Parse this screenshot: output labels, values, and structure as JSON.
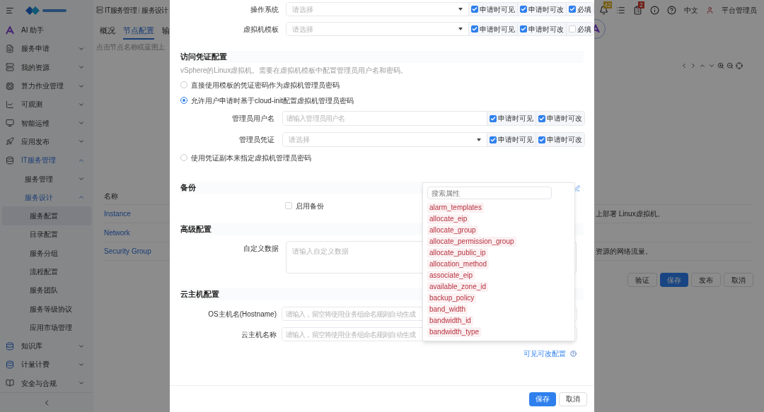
{
  "top_bar": {
    "breadcrumb": [
      "IT服务管理",
      "服务设计"
    ],
    "notification_badge": "42",
    "task_badge": "2",
    "language": "中文",
    "user": "平台管理员"
  },
  "sidebar": {
    "items": [
      {
        "label": "AI 助手",
        "selected": false
      },
      {
        "label": "服务申请",
        "selected": false,
        "expanded": false
      },
      {
        "label": "我的资源",
        "selected": false,
        "expanded": false
      },
      {
        "label": "算力作业管理",
        "selected": false,
        "expanded": false
      },
      {
        "label": "可观测",
        "selected": false,
        "expanded": false
      },
      {
        "label": "智能运维",
        "selected": false,
        "expanded": false
      },
      {
        "label": "应用发布",
        "selected": false,
        "expanded": false
      },
      {
        "label": "IT服务管理",
        "selected": false,
        "expanded": true,
        "children": [
          {
            "label": "服务管理",
            "selected": false,
            "expanded": false
          },
          {
            "label": "服务设计",
            "selected": false,
            "expanded": true,
            "children": [
              {
                "label": "服务配置",
                "selected": true
              },
              {
                "label": "目录配置",
                "selected": false
              },
              {
                "label": "服务分组",
                "selected": false
              },
              {
                "label": "流程配置",
                "selected": false
              },
              {
                "label": "服务团队",
                "selected": false
              },
              {
                "label": "服务等级协议",
                "selected": false
              },
              {
                "label": "应用市场管理",
                "selected": false
              }
            ]
          }
        ]
      },
      {
        "label": "知识库",
        "selected": false,
        "expanded": false
      },
      {
        "label": "计量计费",
        "selected": false,
        "expanded": false
      },
      {
        "label": "安全与合规",
        "selected": false,
        "expanded": false
      }
    ]
  },
  "page": {
    "tabs": [
      {
        "label": "概况",
        "selected": false
      },
      {
        "label": "节点配置",
        "selected": true
      },
      {
        "label": "输",
        "selected": false
      }
    ],
    "hint": "点击节点名称或蓝图上",
    "table": {
      "columns": [
        "名称"
      ],
      "rows": [
        {
          "name": "Instance",
          "column_2": "上部署 Linux虚拟机。"
        },
        {
          "name": "Network"
        },
        {
          "name": "Security Group",
          "column_2": "资源的网络流量。"
        }
      ]
    },
    "buttons": [
      {
        "label": "验证",
        "kind": "default"
      },
      {
        "label": "保存",
        "kind": "primary"
      },
      {
        "label": "发布",
        "kind": "default"
      },
      {
        "label": "取消",
        "kind": "default"
      }
    ]
  },
  "modal": {
    "basic_fields": [
      {
        "label": "操作系统",
        "kind": "select",
        "placeholder": "请选择",
        "options": [
          {
            "label": "申请时可见",
            "checked": true
          },
          {
            "label": "申请时可改",
            "checked": true
          },
          {
            "label": "必填",
            "checked": true
          }
        ]
      },
      {
        "label": "虚拟机模板",
        "kind": "select",
        "placeholder": "请选择",
        "options": [
          {
            "label": "申请时可见",
            "checked": true
          },
          {
            "label": "申请时可改",
            "checked": true
          },
          {
            "label": "必填",
            "checked": false
          }
        ]
      }
    ],
    "credential_section": {
      "title": "访问凭证配置",
      "description": "vSphere的Linux虚拟机。需要在虚拟机模板中配置管理员用户名和密码。",
      "choices": [
        {
          "label": "直接使用模板的凭证密码作为虚拟机管理员密码",
          "selected": false
        },
        {
          "label": "允许用户申请时基于cloud-init配置虚拟机管理员密码",
          "selected": true,
          "fields": [
            {
              "label": "管理员用户名",
              "kind": "input",
              "placeholder": "请输入管理员用户名",
              "options": [
                {
                  "label": "申请时可见",
                  "checked": true
                },
                {
                  "label": "申请时可改",
                  "checked": true
                }
              ]
            },
            {
              "label": "管理员凭证",
              "kind": "select",
              "placeholder": "请选择",
              "options": [
                {
                  "label": "申请时可见",
                  "checked": true
                },
                {
                  "label": "申请时可改",
                  "checked": true
                }
              ]
            }
          ]
        },
        {
          "label": "使用凭证副本来指定虚拟机管理员密码",
          "selected": false
        }
      ]
    },
    "backup_section": {
      "title": "备份",
      "enable": {
        "label": "启用备份",
        "checked": false
      }
    },
    "advanced_section": {
      "title": "高级配置",
      "fields": [
        {
          "label": "自定义数据",
          "kind": "textarea",
          "placeholder": "请输入自定义数据"
        }
      ]
    },
    "vm_section": {
      "title": "云主机配置",
      "fields": [
        {
          "label": "OS主机名(Hostname)",
          "placeholder": "请输入，留空将使用业务组命名规则自动生成"
        },
        {
          "label": "云主机名称",
          "placeholder": "请输入，留空将使用业务组命名规则自动生成"
        }
      ]
    },
    "config_link": "可见可改配置",
    "footer_buttons": [
      {
        "label": "保存",
        "kind": "primary"
      },
      {
        "label": "取消",
        "kind": "default"
      }
    ],
    "property_popover": {
      "placeholder": "搜索属性",
      "items": [
        "alarm_templates",
        "allocate_eip",
        "allocate_group",
        "allocate_permission_group",
        "allocate_public_ip",
        "allocation_method",
        "associate_eip",
        "available_zone_id",
        "backup_policy",
        "band_width",
        "bandwidth_id",
        "bandwidth_type"
      ]
    }
  }
}
